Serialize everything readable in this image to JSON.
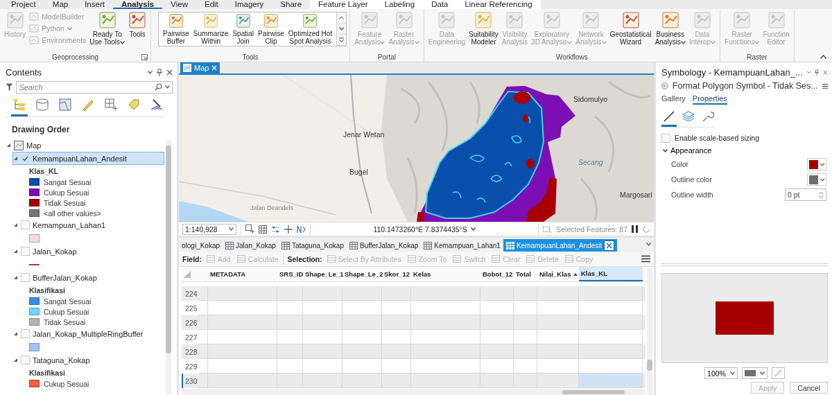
{
  "ribbon_tabs": [
    {
      "label": "Project",
      "selected": false,
      "contextual": false
    },
    {
      "label": "Map",
      "selected": false,
      "contextual": false
    },
    {
      "label": "Insert",
      "selected": false,
      "contextual": false
    },
    {
      "label": "Analysis",
      "selected": true,
      "contextual": false
    },
    {
      "label": "View",
      "selected": false,
      "contextual": false
    },
    {
      "label": "Edit",
      "selected": false,
      "contextual": false
    },
    {
      "label": "Imagery",
      "selected": false,
      "contextual": false
    },
    {
      "label": "Share",
      "selected": false,
      "contextual": false
    },
    {
      "label": "Feature Layer",
      "selected": false,
      "contextual": true
    },
    {
      "label": "Labeling",
      "selected": false,
      "contextual": true
    },
    {
      "label": "Data",
      "selected": false,
      "contextual": true
    },
    {
      "label": "Linear Referencing",
      "selected": false,
      "contextual": true
    }
  ],
  "ribbon": {
    "groups": [
      {
        "label": "Geoprocessing",
        "kind": "buttons",
        "launcher": true,
        "buttons": [
          {
            "kind": "large",
            "label": "History",
            "disabled": true,
            "dropdown": false
          },
          {
            "kind": "small",
            "label": "ModelBuilder",
            "disabled": true,
            "dropdown": false
          },
          {
            "kind": "small",
            "label": "Python",
            "disabled": true,
            "dropdown": true
          },
          {
            "kind": "small",
            "label": "Environments",
            "disabled": true,
            "dropdown": false
          },
          {
            "kind": "large",
            "label": "Ready To\nUse Tools",
            "disabled": false,
            "dropdown": true
          },
          {
            "kind": "large",
            "label": "Tools",
            "disabled": false,
            "dropdown": false
          }
        ]
      },
      {
        "label": "Tools",
        "kind": "gallery",
        "launcher": false,
        "buttons": [
          {
            "kind": "large",
            "label": "Pairwise\nBuffer",
            "disabled": false,
            "dropdown": false
          },
          {
            "kind": "large",
            "label": "Summarize\nWithin",
            "disabled": false,
            "dropdown": false
          },
          {
            "kind": "large",
            "label": "Spatial\nJoin",
            "disabled": false,
            "dropdown": false
          },
          {
            "kind": "large",
            "label": "Pairwise\nClip",
            "disabled": false,
            "dropdown": false
          },
          {
            "kind": "large",
            "label": "Optimized Hot\nSpot Analysis",
            "disabled": false,
            "dropdown": false
          }
        ]
      },
      {
        "label": "Portal",
        "kind": "buttons",
        "launcher": false,
        "buttons": [
          {
            "kind": "large",
            "label": "Feature\nAnalysis",
            "disabled": true,
            "dropdown": true
          },
          {
            "kind": "large",
            "label": "Raster\nAnalysis",
            "disabled": true,
            "dropdown": true
          }
        ]
      },
      {
        "label": "Workflows",
        "kind": "buttons",
        "launcher": false,
        "buttons": [
          {
            "kind": "large",
            "label": "Data\nEngineering",
            "disabled": true,
            "dropdown": false
          },
          {
            "kind": "large",
            "label": "Suitability\nModeler",
            "disabled": false,
            "dropdown": false
          },
          {
            "kind": "large",
            "label": "Visibility\nAnalysis",
            "disabled": true,
            "dropdown": false
          },
          {
            "kind": "large",
            "label": "Exploratory\n3D Analysis",
            "disabled": true,
            "dropdown": true
          },
          {
            "kind": "large",
            "label": "Network\nAnalysis",
            "disabled": true,
            "dropdown": true
          },
          {
            "kind": "large",
            "label": "Geostatistical\nWizard",
            "disabled": false,
            "dropdown": false
          },
          {
            "kind": "large",
            "label": "Business\nAnalysis",
            "disabled": false,
            "dropdown": true
          },
          {
            "kind": "large",
            "label": "Data\nInterop",
            "disabled": true,
            "dropdown": true
          }
        ]
      },
      {
        "label": "Raster",
        "kind": "buttons",
        "launcher": false,
        "buttons": [
          {
            "kind": "large",
            "label": "Raster\nFunctions",
            "disabled": true,
            "dropdown": true
          },
          {
            "kind": "large",
            "label": "Function\nEditor",
            "disabled": true,
            "dropdown": false
          }
        ]
      }
    ]
  },
  "contents": {
    "title": "Contents",
    "search_placeholder": "Search",
    "views": [
      {
        "selected": true
      },
      {
        "selected": false
      },
      {
        "selected": false
      },
      {
        "selected": false
      },
      {
        "selected": false
      },
      {
        "selected": false
      },
      {
        "selected": false
      }
    ],
    "section": "Drawing Order",
    "tree": [
      {
        "label": "Map",
        "expanded": true,
        "children": [
          {
            "label": "KemampuanLahan_Andesit",
            "checked": true,
            "selected": true,
            "expanded": true,
            "legend_title": "Klas_KL",
            "classes": [
              {
                "label": "Sangat Sesuai",
                "color": "#0a4eac",
                "kind": "fill"
              },
              {
                "label": "Cukup Sesuai",
                "color": "#7b0fb4",
                "kind": "fill"
              },
              {
                "label": "Tidak Sesuai",
                "color": "#a80000",
                "kind": "fill"
              },
              {
                "label": "<all other values>",
                "color": "#777777",
                "kind": "fill"
              }
            ]
          },
          {
            "label": "Kemampuan_Lahan1",
            "checked": false,
            "selected": false,
            "expanded": true,
            "classes": [
              {
                "color": "#fbd5ea",
                "kind": "fill"
              }
            ]
          },
          {
            "label": "Jalan_Kokap",
            "checked": false,
            "selected": false,
            "expanded": true,
            "classes": [
              {
                "color": "#b03050",
                "kind": "line"
              }
            ]
          },
          {
            "label": "BufferJalan_Kokap",
            "checked": false,
            "selected": false,
            "expanded": true,
            "legend_title": "Klasifikasi",
            "classes": [
              {
                "label": "Sangat Sesuai",
                "color": "#3a8ee6",
                "kind": "fill"
              },
              {
                "label": "Cukup Sesuai",
                "color": "#6fd6fb",
                "kind": "fill"
              },
              {
                "label": "Tidak Sesuai",
                "color": "#b4b4b4",
                "kind": "fill"
              }
            ]
          },
          {
            "label": "Jalan_Kokap_MultipleRingBuffer",
            "checked": false,
            "selected": false,
            "expanded": true,
            "classes": [
              {
                "color": "#a3c4f7",
                "kind": "fill"
              }
            ]
          },
          {
            "label": "Tataguna_Kokap",
            "checked": false,
            "selected": false,
            "expanded": true,
            "legend_title": "Klasifikasi",
            "classes": [
              {
                "label": "Cukup Sesuai",
                "color": "#f0603c",
                "kind": "fill"
              }
            ]
          }
        ]
      }
    ]
  },
  "map": {
    "tab": {
      "label": "Map",
      "selected": true
    },
    "places": [
      {
        "label": "Jenar Wetan",
        "kind": "town"
      },
      {
        "label": "Bugel",
        "kind": "town"
      },
      {
        "label": "Sidomulyo",
        "kind": "town"
      },
      {
        "label": "Secang",
        "kind": "water"
      },
      {
        "label": "Margosari",
        "kind": "town"
      },
      {
        "label": "Jalan Deandels",
        "kind": "road"
      }
    ],
    "scale": "1:140,928",
    "coordinates": "110.1473260°E 7.8374435°S",
    "selected_features": "Selected Features: 87"
  },
  "table_tabs": [
    {
      "label": "ologi_Kokap",
      "selected": false,
      "icon": false
    },
    {
      "label": "Jalan_Kokap",
      "selected": false,
      "icon": true
    },
    {
      "label": "Tataguna_Kokap",
      "selected": false,
      "icon": true
    },
    {
      "label": "BufferJalan_Kokap",
      "selected": false,
      "icon": true
    },
    {
      "label": "Kemampuan_Lahan1",
      "selected": false,
      "icon": true
    },
    {
      "label": "KemampuanLahan_Andesit",
      "selected": true,
      "icon": true
    }
  ],
  "toolbar": {
    "groups": [
      {
        "label": "Field:",
        "items": [
          {
            "label": "Add",
            "disabled": true
          },
          {
            "label": "Calculate",
            "disabled": true
          }
        ]
      },
      {
        "label": "Selection:",
        "items": [
          {
            "label": "Select By Attributes",
            "disabled": true
          },
          {
            "label": "Zoom To",
            "disabled": true
          },
          {
            "label": "Switch",
            "disabled": true
          },
          {
            "label": "Clear",
            "disabled": true
          },
          {
            "label": "Delete",
            "disabled": true
          },
          {
            "label": "Copy",
            "disabled": true
          }
        ]
      }
    ]
  },
  "table": {
    "columns": [
      {
        "label": "METADATA",
        "sorted": false,
        "selected": false
      },
      {
        "label": "SRS_ID",
        "sorted": false,
        "selected": false
      },
      {
        "label": "Shape_Le_1",
        "sorted": false,
        "selected": false
      },
      {
        "label": "Shape_Le_2",
        "sorted": false,
        "selected": false
      },
      {
        "label": "Skor_12",
        "sorted": false,
        "selected": false
      },
      {
        "label": "Kelas",
        "sorted": false,
        "selected": false
      },
      {
        "label": "Bobot_12",
        "sorted": false,
        "selected": false
      },
      {
        "label": "Total",
        "sorted": false,
        "selected": false
      },
      {
        "label": "Nilai_Klas",
        "sorted": true,
        "selected": false
      },
      {
        "label": "Klas_KL",
        "sorted": false,
        "selected": true
      }
    ],
    "rows": [
      {
        "number": "224",
        "selected": false
      },
      {
        "number": "225",
        "selected": false
      },
      {
        "number": "226",
        "selected": false
      },
      {
        "number": "227",
        "selected": false
      },
      {
        "number": "228",
        "selected": false
      },
      {
        "number": "229",
        "selected": false
      },
      {
        "number": "230",
        "selected": true
      }
    ]
  },
  "symbology": {
    "title": "Symbology - KemampuanLahan_...",
    "subtitle": "Format Polygon Symbol - Tidak Ses...",
    "tabs": [
      {
        "label": "Gallery",
        "selected": false
      },
      {
        "label": "Properties",
        "selected": true
      }
    ],
    "panels": [
      {
        "selected": true
      },
      {
        "selected": false
      },
      {
        "selected": false
      }
    ],
    "scale_sizing": {
      "label": "Enable scale-based sizing",
      "checked": false
    },
    "appearance": {
      "label": "Appearance",
      "expanded": true,
      "properties": [
        {
          "kind": "color",
          "label": "Color",
          "color": "#a80000"
        },
        {
          "kind": "color",
          "label": "Outline color",
          "color": "#6e6e6e"
        },
        {
          "kind": "number",
          "label": "Outline width",
          "value": "0 pt"
        }
      ]
    },
    "zoom": "100%",
    "buttons": [
      {
        "label": "Apply",
        "disabled": true
      },
      {
        "label": "Cancel",
        "disabled": false
      }
    ]
  }
}
